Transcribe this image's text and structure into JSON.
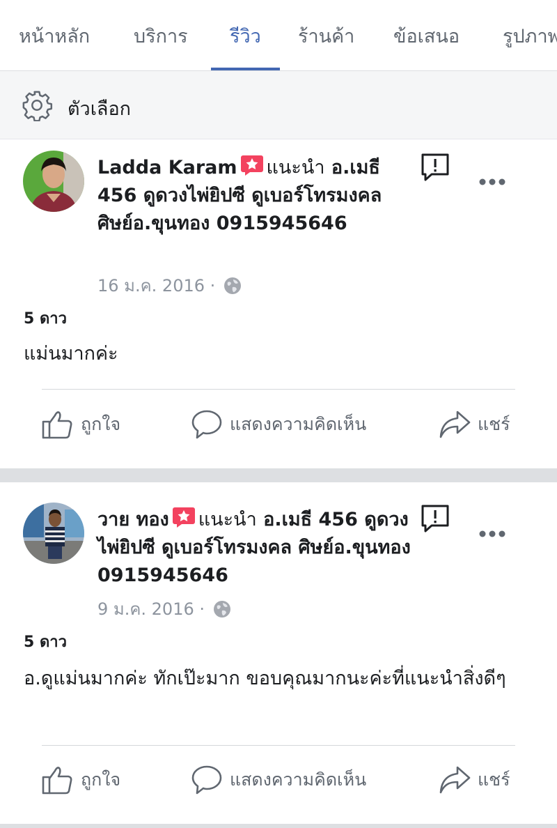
{
  "tabs": [
    {
      "label": "หน้าหลัก",
      "active": false
    },
    {
      "label": "บริการ",
      "active": false
    },
    {
      "label": "รีวิว",
      "active": true
    },
    {
      "label": "ร้านค้า",
      "active": false
    },
    {
      "label": "ข้อเสนอ",
      "active": false
    },
    {
      "label": "รูปภาพ",
      "active": false
    }
  ],
  "options": {
    "label": "ตัวเลือก",
    "icon": "gear-icon"
  },
  "colors": {
    "accent": "#4267b2",
    "recommend": "#f3425f",
    "muted": "#606770",
    "meta": "#8d949e"
  },
  "actions": {
    "like": "ถูกใจ",
    "comment": "แสดงความคิดเห็น",
    "share": "แชร์"
  },
  "reviews": [
    {
      "author": "Ladda Karam",
      "verb": "แนะนำ",
      "page_name": "อ.เมธี 456 ดูดวงไพ่ยิปซี ดูเบอร์โทรมงคล ศิษย์อ.ขุนทอง 0915945646",
      "date": "16 ม.ค. 2016",
      "rating": "5 ดาว",
      "text": "แม่นมากค่ะ"
    },
    {
      "author": "วาย ทอง",
      "verb": "แนะนำ",
      "page_name": "อ.เมธี 456 ดูดวงไพ่ยิปซี ดูเบอร์โทรมงคล ศิษย์อ.ขุนทอง 0915945646",
      "date": "9 ม.ค. 2016",
      "rating": "5 ดาว",
      "text": "อ.ดูแม่นมากค่ะ ทักเป๊ะมาก ขอบคุณมากนะค่ะที่แนะนำสิ่งดีๆ"
    }
  ]
}
